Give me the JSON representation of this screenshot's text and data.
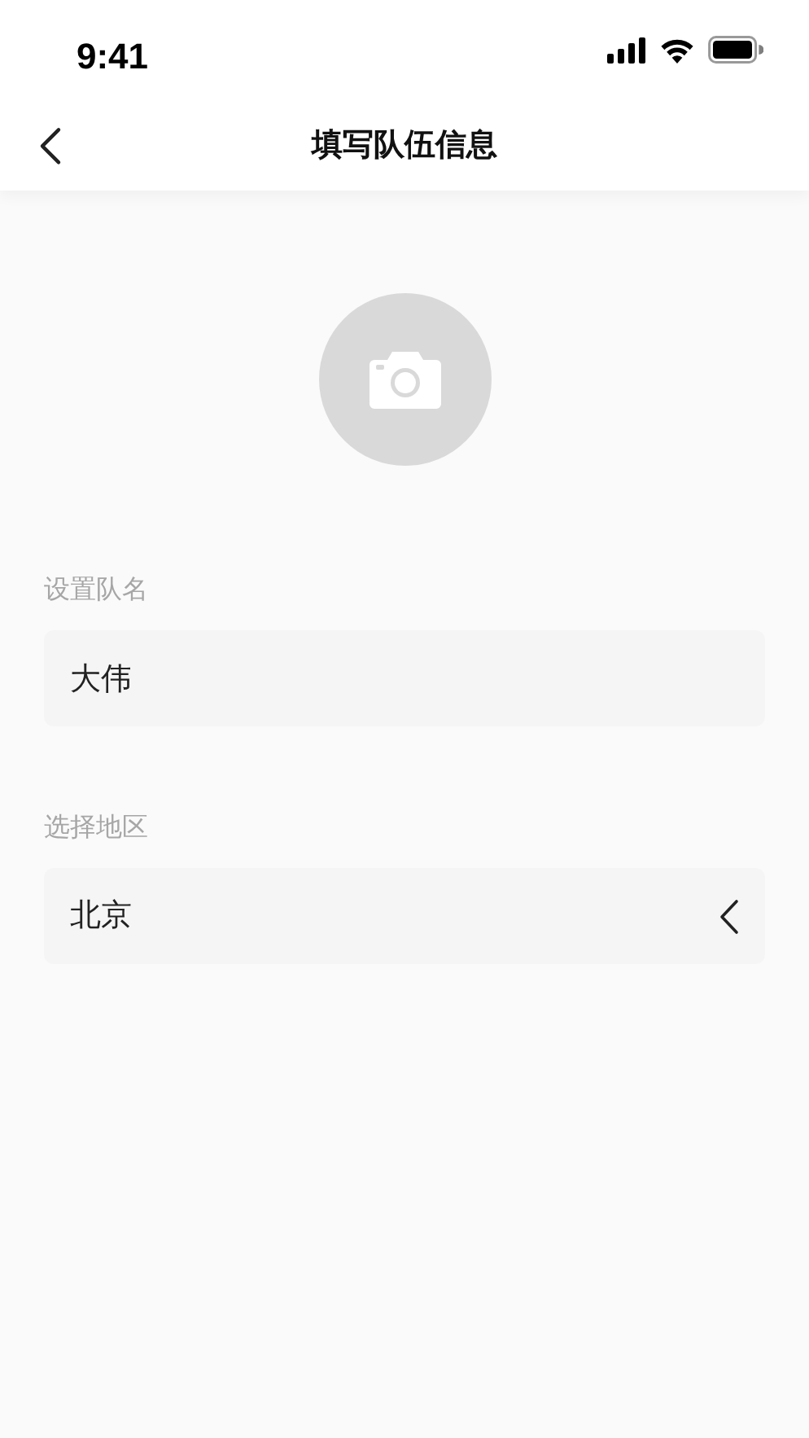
{
  "status_bar": {
    "time": "9:41"
  },
  "nav_bar": {
    "title": "填写队伍信息"
  },
  "avatar": {
    "kind": "camera"
  },
  "fields": [
    {
      "kind": "text",
      "label": "设置队名",
      "value": "大伟"
    },
    {
      "kind": "select",
      "label": "选择地区",
      "value": "北京"
    }
  ]
}
